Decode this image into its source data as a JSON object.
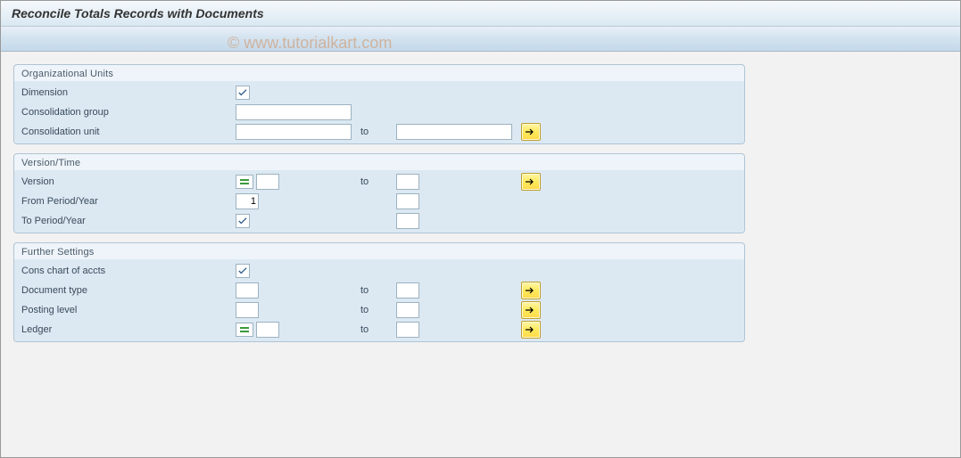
{
  "title": "Reconcile Totals Records with Documents",
  "watermark": "© www.tutorialkart.com",
  "groups": {
    "org": {
      "title": "Organizational Units",
      "dimension_label": "Dimension",
      "consgroup_label": "Consolidation group",
      "consunit_label": "Consolidation unit",
      "to_label": "to"
    },
    "vt": {
      "title": "Version/Time",
      "version_label": "Version",
      "from_period_label": "From Period/Year",
      "from_period_value": "1",
      "to_period_label": "To Period/Year",
      "to_label": "to"
    },
    "fs": {
      "title": "Further Settings",
      "chart_label": "Cons chart of accts",
      "doctype_label": "Document type",
      "postlevel_label": "Posting level",
      "ledger_label": "Ledger",
      "to_label": "to"
    }
  }
}
